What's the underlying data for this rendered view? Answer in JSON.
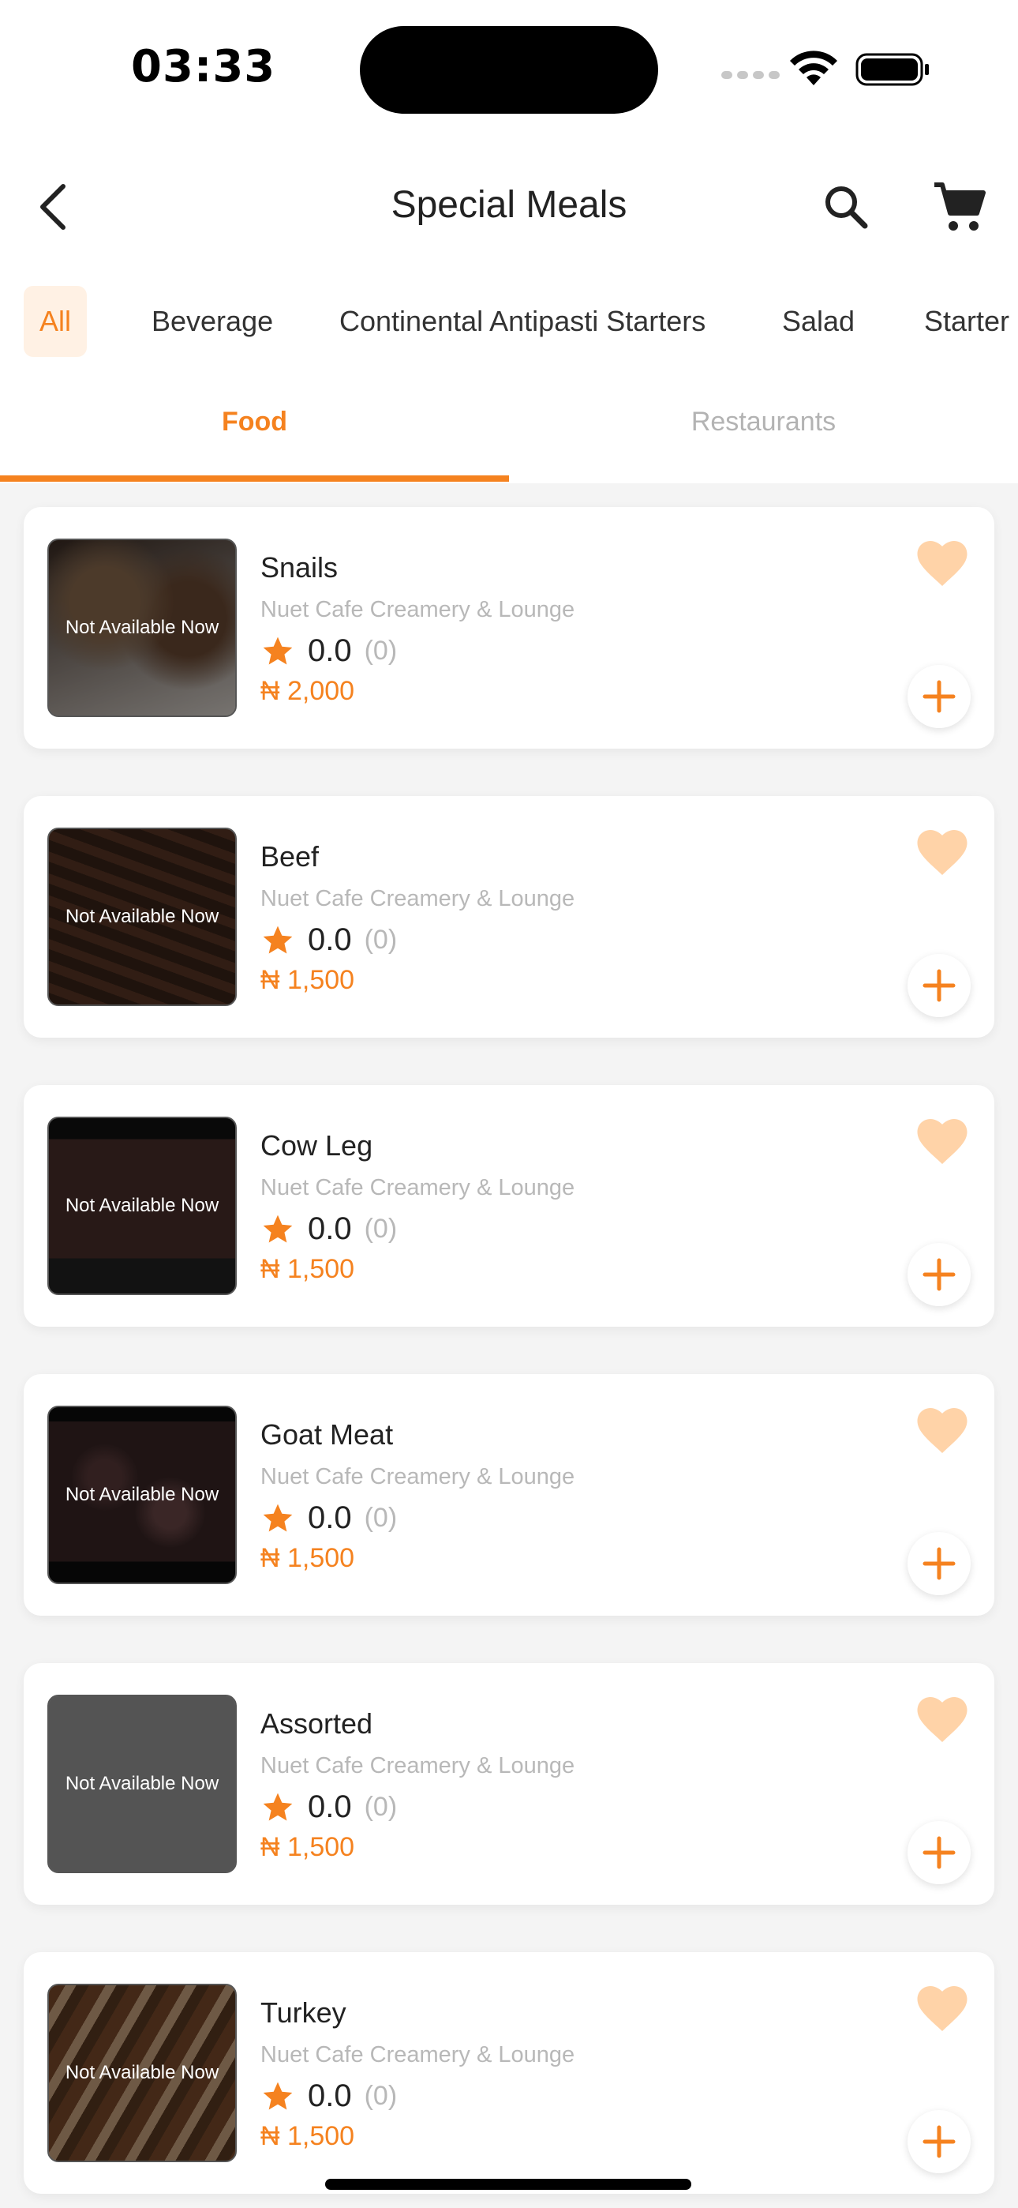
{
  "status_bar": {
    "time": "03:33"
  },
  "header": {
    "title": "Special Meals",
    "back_icon": "chevron-left-icon",
    "search_icon": "search-icon",
    "cart_icon": "cart-icon"
  },
  "categories": [
    {
      "label": "All",
      "active": true
    },
    {
      "label": "Beverage",
      "active": false
    },
    {
      "label": "Continental Antipasti Starters",
      "active": false
    },
    {
      "label": "Salad",
      "active": false
    },
    {
      "label": "Starter",
      "active": false
    }
  ],
  "tabs": [
    {
      "label": "Food",
      "active": true
    },
    {
      "label": "Restaurants",
      "active": false
    }
  ],
  "colors": {
    "accent": "#f5821f",
    "accent_light": "#fff1e4",
    "favorite": "#ffd3a8"
  },
  "items": [
    {
      "name": "Snails",
      "vendor": "Nuet Cafe Creamery & Lounge",
      "rating": "0.0",
      "rating_count": "(0)",
      "price": "₦ 2,000",
      "availability": "Not Available Now"
    },
    {
      "name": "Beef",
      "vendor": "Nuet Cafe Creamery & Lounge",
      "rating": "0.0",
      "rating_count": "(0)",
      "price": "₦ 1,500",
      "availability": "Not Available Now"
    },
    {
      "name": "Cow Leg",
      "vendor": "Nuet Cafe Creamery & Lounge",
      "rating": "0.0",
      "rating_count": "(0)",
      "price": "₦ 1,500",
      "availability": "Not Available Now"
    },
    {
      "name": "Goat Meat",
      "vendor": "Nuet Cafe Creamery & Lounge",
      "rating": "0.0",
      "rating_count": "(0)",
      "price": "₦ 1,500",
      "availability": "Not Available Now"
    },
    {
      "name": "Assorted",
      "vendor": "Nuet Cafe Creamery & Lounge",
      "rating": "0.0",
      "rating_count": "(0)",
      "price": "₦ 1,500",
      "availability": "Not Available Now"
    },
    {
      "name": "Turkey",
      "vendor": "Nuet Cafe Creamery & Lounge",
      "rating": "0.0",
      "rating_count": "(0)",
      "price": "₦ 1,500",
      "availability": "Not Available Now"
    }
  ]
}
